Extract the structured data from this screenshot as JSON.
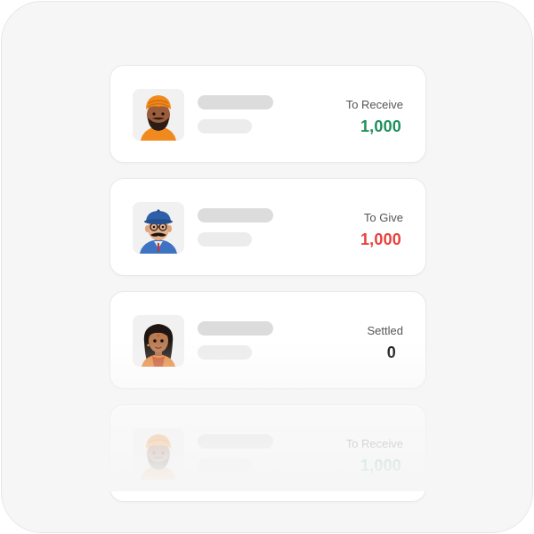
{
  "entries": [
    {
      "status_label": "To Receive",
      "amount": "1,000",
      "amount_color": "#1e8f5c",
      "avatar": "turban-man-avatar"
    },
    {
      "status_label": "To Give",
      "amount": "1,000",
      "amount_color": "#e8403a",
      "avatar": "cap-mustache-man-avatar"
    },
    {
      "status_label": "Settled",
      "amount": "0",
      "amount_color": "#111111",
      "avatar": "woman-avatar"
    },
    {
      "status_label": "To Receive",
      "amount": "1,000",
      "amount_color": "#1e8f5c",
      "avatar": "turban-man-avatar"
    }
  ]
}
